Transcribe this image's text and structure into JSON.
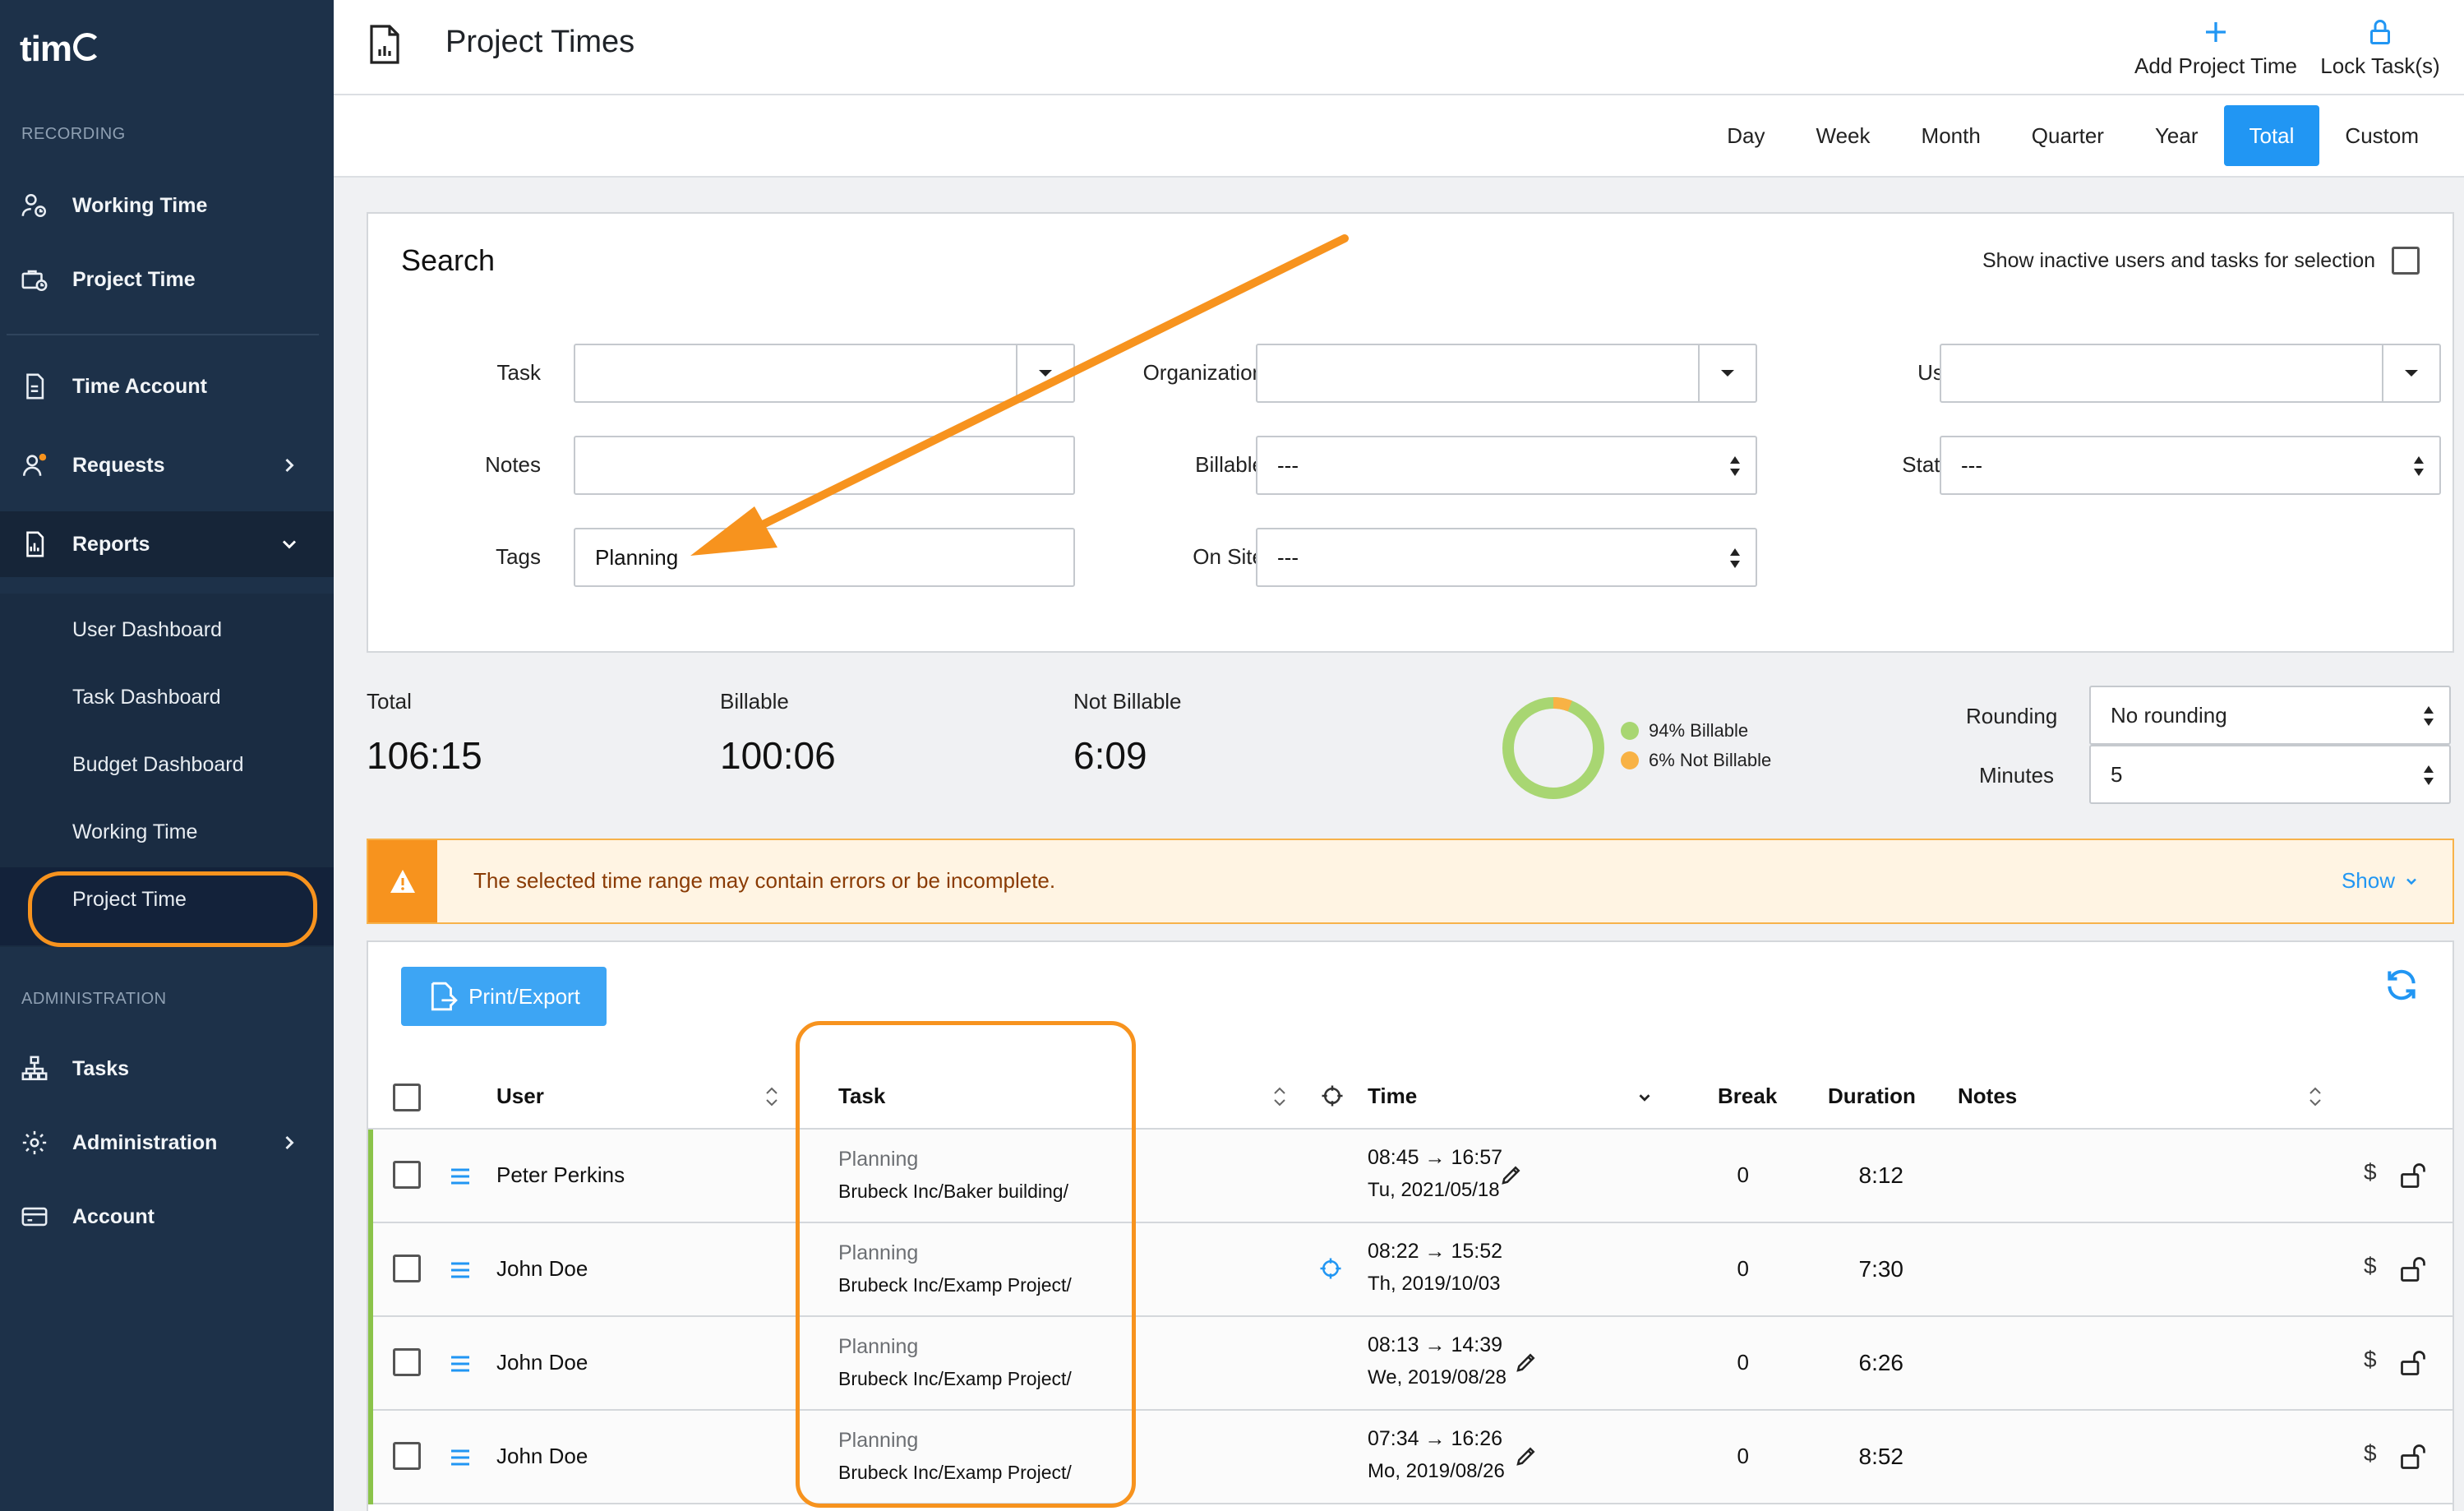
{
  "app": {
    "logo_text": "tim"
  },
  "sidebar": {
    "sections": {
      "recording": "RECORDING",
      "administration": "ADMINISTRATION"
    },
    "items": [
      {
        "label": "Working Time",
        "icon": "user-clock-icon"
      },
      {
        "label": "Project Time",
        "icon": "briefcase-clock-icon"
      },
      {
        "label": "Time Account",
        "icon": "document-icon"
      },
      {
        "label": "Requests",
        "icon": "user-request-icon"
      },
      {
        "label": "Reports",
        "icon": "report-icon"
      },
      {
        "label": "Tasks",
        "icon": "hierarchy-icon"
      },
      {
        "label": "Administration",
        "icon": "gear-icon"
      },
      {
        "label": "Account",
        "icon": "card-icon"
      }
    ],
    "report_subitems": [
      "User Dashboard",
      "Task Dashboard",
      "Budget Dashboard",
      "Working Time",
      "Project Time"
    ]
  },
  "header": {
    "title": "Project Times",
    "add_label": "Add Project Time",
    "lock_label": "Lock Task(s)"
  },
  "periods": [
    "Day",
    "Week",
    "Month",
    "Quarter",
    "Year",
    "Total",
    "Custom"
  ],
  "active_period": "Total",
  "search": {
    "title": "Search",
    "show_inactive": "Show inactive users and tasks for selection",
    "labels": {
      "task": "Task",
      "organization": "Organization",
      "user": "User",
      "notes": "Notes",
      "billable": "Billable",
      "status": "Status",
      "tags": "Tags",
      "on_site": "On Site"
    },
    "values": {
      "task": "",
      "organization": "",
      "user": "",
      "notes": "",
      "billable": "---",
      "status": "---",
      "tags": "Planning",
      "on_site": "---"
    }
  },
  "stats": {
    "total_label": "Total",
    "total": "106:15",
    "billable_label": "Billable",
    "billable": "100:06",
    "not_billable_label": "Not Billable",
    "not_billable": "6:09",
    "legend_billable": "94% Billable",
    "legend_not_billable": "6% Not Billable",
    "billable_fraction": 0.94,
    "colors": {
      "billable": "#a8d672",
      "not_billable": "#f8b245"
    }
  },
  "rounding": {
    "label": "Rounding",
    "value": "No rounding",
    "minutes_label": "Minutes",
    "minutes": "5"
  },
  "warning": {
    "text": "The selected time range may contain errors or be incomplete.",
    "show": "Show"
  },
  "table": {
    "export_label": "Print/Export",
    "columns": {
      "user": "User",
      "task": "Task",
      "time": "Time",
      "break": "Break",
      "duration": "Duration",
      "notes": "Notes"
    },
    "rows": [
      {
        "user": "Peter Perkins",
        "tag": "Planning",
        "path": "Brubeck Inc/Baker building/",
        "range": "08:45 → 16:57",
        "date": "Tu, 2021/05/18",
        "break": "0",
        "duration": "8:12",
        "located": false,
        "editable": true
      },
      {
        "user": "John Doe",
        "tag": "Planning",
        "path": "Brubeck Inc/Examp Project/",
        "range": "08:22 → 15:52",
        "date": "Th, 2019/10/03",
        "break": "0",
        "duration": "7:30",
        "located": true,
        "editable": false
      },
      {
        "user": "John Doe",
        "tag": "Planning",
        "path": "Brubeck Inc/Examp Project/",
        "range": "08:13 → 14:39",
        "date": "We, 2019/08/28",
        "break": "0",
        "duration": "6:26",
        "located": false,
        "editable": true
      },
      {
        "user": "John Doe",
        "tag": "Planning",
        "path": "Brubeck Inc/Examp Project/",
        "range": "07:34 → 16:26",
        "date": "Mo, 2019/08/26",
        "break": "0",
        "duration": "8:52",
        "located": false,
        "editable": true
      }
    ],
    "currency_symbol": "$"
  },
  "accent_colors": {
    "primary": "#2196f3",
    "highlight": "#f7931e",
    "sidebar": "#1d3149"
  }
}
